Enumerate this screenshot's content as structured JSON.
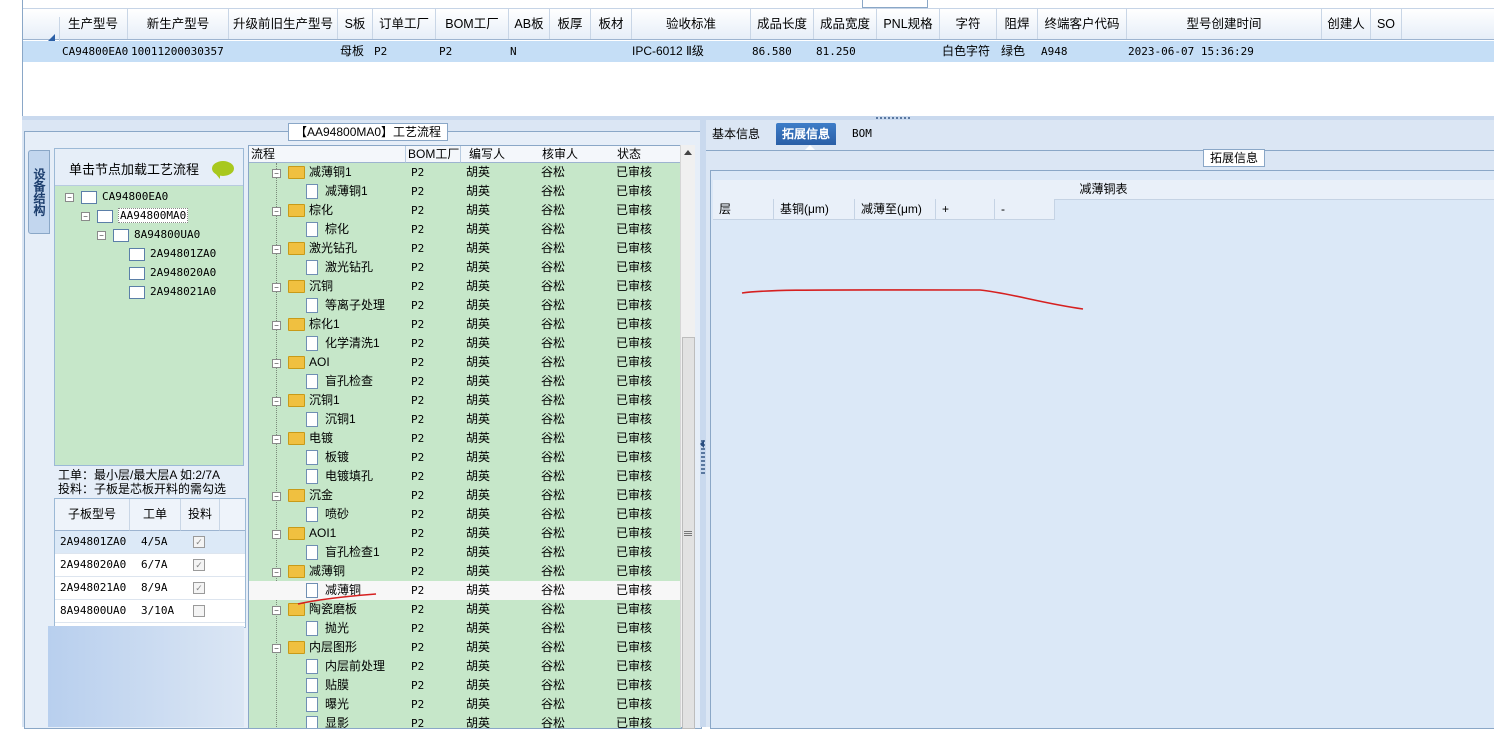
{
  "top_grid": {
    "columns": [
      "生产型号",
      "新生产型号",
      "升级前旧生产型号",
      "S板",
      "订单工厂",
      "BOM工厂",
      "AB板",
      "板厚",
      "板材",
      "验收标准",
      "成品长度",
      "成品宽度",
      "PNL规格",
      "字符",
      "阻焊",
      "终端客户代码",
      "型号创建时间",
      "创建人",
      "SO"
    ],
    "row": {
      "prod_model": "CA94800EA0",
      "new_model": "10011200030357",
      "old_model": "",
      "s_board": "母板",
      "order_factory": "P2",
      "bom_factory": "P2",
      "ab_board": "N",
      "thickness": "",
      "material": "",
      "standard": "IPC-6012 Ⅱ级",
      "length": "86.580",
      "width": "81.250",
      "pnl": "",
      "char": "白色字符",
      "mask": "绿色",
      "customer": "A948",
      "created": "2023-06-07 15:36:29",
      "creator": "",
      "so": ""
    }
  },
  "flow_panel": {
    "title": "【AA94800MA0】工艺流程",
    "vertical_tab": "设备结构",
    "tree_header": "单击节点加载工艺流程",
    "tree": [
      "CA94800EA0",
      "AA94800MA0",
      "8A94800UA0",
      "2A94801ZA0",
      "2A948020A0",
      "2A948021A0"
    ],
    "note_line1": "工单：最小层/最大层A 如:2/7A",
    "note_line2": "投料：子板是芯板开料的需勾选",
    "sub_columns": [
      "子板型号",
      "工单",
      "投料"
    ],
    "sub_rows": [
      {
        "model": "2A94801ZA0",
        "order": "4/5A",
        "checked": true
      },
      {
        "model": "2A948020A0",
        "order": "6/7A",
        "checked": true
      },
      {
        "model": "2A948021A0",
        "order": "8/9A",
        "checked": true
      },
      {
        "model": "8A94800UA0",
        "order": "3/10A",
        "checked": false
      }
    ]
  },
  "flow_grid": {
    "columns": [
      "流程",
      "BOM工厂",
      "编写人",
      "核审人",
      "状态"
    ],
    "rows": [
      {
        "name": "减薄铜1",
        "level": 0,
        "f": "P2",
        "w": "胡英",
        "r": "谷松",
        "s": "已审核"
      },
      {
        "name": "减薄铜1",
        "level": 1,
        "f": "P2",
        "w": "胡英",
        "r": "谷松",
        "s": "已审核"
      },
      {
        "name": "棕化",
        "level": 0,
        "f": "P2",
        "w": "胡英",
        "r": "谷松",
        "s": "已审核"
      },
      {
        "name": "棕化",
        "level": 1,
        "f": "P2",
        "w": "胡英",
        "r": "谷松",
        "s": "已审核"
      },
      {
        "name": "激光钻孔",
        "level": 0,
        "f": "P2",
        "w": "胡英",
        "r": "谷松",
        "s": "已审核"
      },
      {
        "name": "激光钻孔",
        "level": 1,
        "f": "P2",
        "w": "胡英",
        "r": "谷松",
        "s": "已审核"
      },
      {
        "name": "沉铜",
        "level": 0,
        "f": "P2",
        "w": "胡英",
        "r": "谷松",
        "s": "已审核"
      },
      {
        "name": "等离子处理",
        "level": 1,
        "f": "P2",
        "w": "胡英",
        "r": "谷松",
        "s": "已审核"
      },
      {
        "name": "棕化1",
        "level": 0,
        "f": "P2",
        "w": "胡英",
        "r": "谷松",
        "s": "已审核"
      },
      {
        "name": "化学清洗1",
        "level": 1,
        "f": "P2",
        "w": "胡英",
        "r": "谷松",
        "s": "已审核"
      },
      {
        "name": "AOI",
        "level": 0,
        "f": "P2",
        "w": "胡英",
        "r": "谷松",
        "s": "已审核"
      },
      {
        "name": "盲孔检查",
        "level": 1,
        "f": "P2",
        "w": "胡英",
        "r": "谷松",
        "s": "已审核"
      },
      {
        "name": "沉铜1",
        "level": 0,
        "f": "P2",
        "w": "胡英",
        "r": "谷松",
        "s": "已审核"
      },
      {
        "name": "沉铜1",
        "level": 1,
        "f": "P2",
        "w": "胡英",
        "r": "谷松",
        "s": "已审核"
      },
      {
        "name": "电镀",
        "level": 0,
        "f": "P2",
        "w": "胡英",
        "r": "谷松",
        "s": "已审核"
      },
      {
        "name": "板镀",
        "level": 1,
        "f": "P2",
        "w": "胡英",
        "r": "谷松",
        "s": "已审核"
      },
      {
        "name": "电镀填孔",
        "level": 1,
        "f": "P2",
        "w": "胡英",
        "r": "谷松",
        "s": "已审核"
      },
      {
        "name": "沉金",
        "level": 0,
        "f": "P2",
        "w": "胡英",
        "r": "谷松",
        "s": "已审核"
      },
      {
        "name": "喷砂",
        "level": 1,
        "f": "P2",
        "w": "胡英",
        "r": "谷松",
        "s": "已审核"
      },
      {
        "name": "AOI1",
        "level": 0,
        "f": "P2",
        "w": "胡英",
        "r": "谷松",
        "s": "已审核"
      },
      {
        "name": "盲孔检查1",
        "level": 1,
        "f": "P2",
        "w": "胡英",
        "r": "谷松",
        "s": "已审核"
      },
      {
        "name": "减薄铜",
        "level": 0,
        "f": "P2",
        "w": "胡英",
        "r": "谷松",
        "s": "已审核"
      },
      {
        "name": "减薄铜",
        "level": 1,
        "f": "P2",
        "w": "胡英",
        "r": "谷松",
        "s": "已审核",
        "highlight": true
      },
      {
        "name": "陶瓷磨板",
        "level": 0,
        "f": "P2",
        "w": "胡英",
        "r": "谷松",
        "s": "已审核"
      },
      {
        "name": "抛光",
        "level": 1,
        "f": "P2",
        "w": "胡英",
        "r": "谷松",
        "s": "已审核"
      },
      {
        "name": "内层图形",
        "level": 0,
        "f": "P2",
        "w": "胡英",
        "r": "谷松",
        "s": "已审核"
      },
      {
        "name": "内层前处理",
        "level": 1,
        "f": "P2",
        "w": "胡英",
        "r": "谷松",
        "s": "已审核"
      },
      {
        "name": "贴膜",
        "level": 1,
        "f": "P2",
        "w": "胡英",
        "r": "谷松",
        "s": "已审核"
      },
      {
        "name": "曝光",
        "level": 1,
        "f": "P2",
        "w": "胡英",
        "r": "谷松",
        "s": "已审核"
      },
      {
        "name": "显影",
        "level": 1,
        "f": "P2",
        "w": "胡英",
        "r": "谷松",
        "s": "已审核"
      }
    ]
  },
  "right_panel": {
    "tabs": [
      "基本信息",
      "拓展信息",
      "BOM"
    ],
    "active_tab": 1,
    "section_title": "拓展信息",
    "table_title": "减薄铜表",
    "table_columns": [
      "层",
      "基铜(μm)",
      "减薄至(μm)",
      "+",
      "-"
    ]
  },
  "colors": {
    "accent": "#2a67b3",
    "grid_select": "#c5def6",
    "tree_bg": "#c6e7c9",
    "annotation": "#d62020"
  }
}
